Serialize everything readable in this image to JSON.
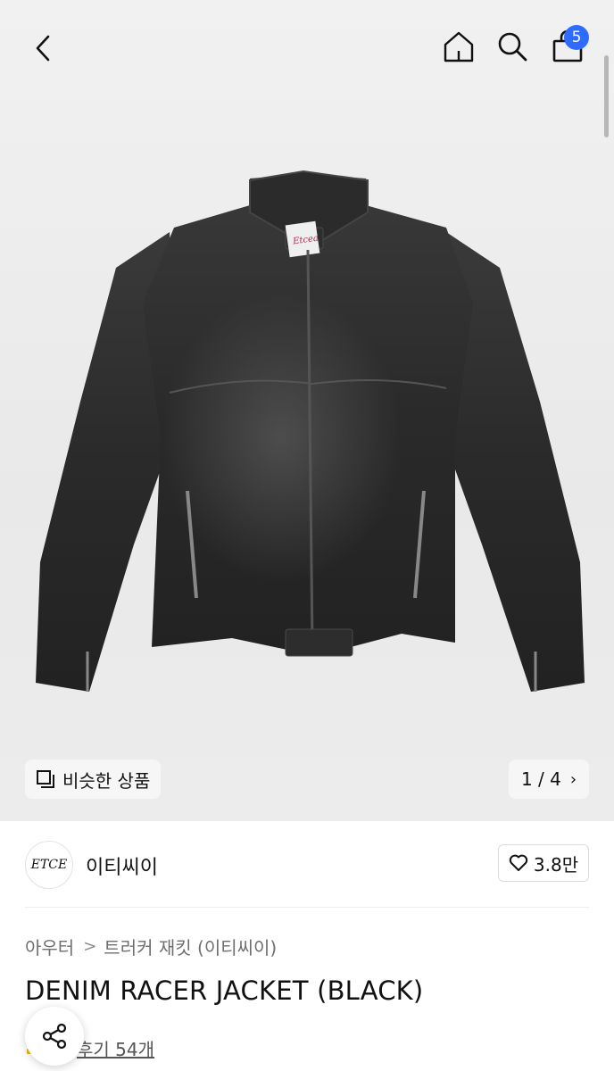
{
  "header": {
    "back_icon": "chevron-left-icon",
    "home_icon": "home-icon",
    "search_icon": "search-icon",
    "cart_icon": "shopping-bag-icon",
    "cart_badge": "5",
    "badge_color": "#2f6bff"
  },
  "gallery": {
    "similar_label": "비슷한 상품",
    "page_indicator": "1 / 4",
    "page_chevron": "›",
    "jacket_label_text": "Etcea"
  },
  "brand": {
    "logo_text": "ETCE",
    "name": "이티씨이",
    "likes": "3.8만"
  },
  "breadcrumb": {
    "category": "아우터",
    "separator": ">",
    "subcategory": "트러커 재킷 (이티씨이)"
  },
  "product": {
    "title": "DENIM RACER JACKET (BLACK)",
    "review_text": "후기 54개"
  },
  "colors": {
    "hero_bg": "#efefef",
    "accent_star": "#f2b21b"
  }
}
